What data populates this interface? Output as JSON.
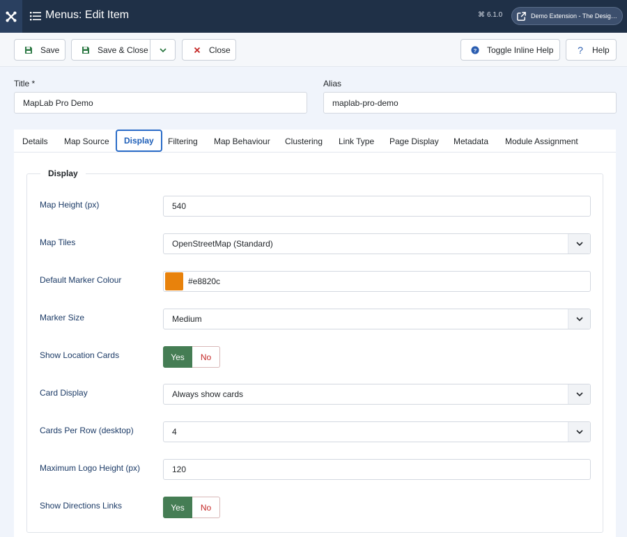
{
  "header": {
    "title": "Menus: Edit Item",
    "version": "6.1.0",
    "site_link": "Demo Extension - The Design..."
  },
  "toolbar": {
    "save": "Save",
    "save_close": "Save & Close",
    "close": "Close",
    "toggle_help": "Toggle Inline Help",
    "help": "Help"
  },
  "form": {
    "title_label": "Title *",
    "title_value": "MapLab Pro Demo",
    "alias_label": "Alias",
    "alias_value": "maplab-pro-demo"
  },
  "tabs": [
    "Details",
    "Map Source",
    "Display",
    "Filtering",
    "Map Behaviour",
    "Clustering",
    "Link Type",
    "Page Display",
    "Metadata",
    "Module Assignment"
  ],
  "active_tab": "Display",
  "fieldset": {
    "legend": "Display",
    "fields": {
      "map_height": {
        "label": "Map Height (px)",
        "value": "540"
      },
      "map_tiles": {
        "label": "Map Tiles",
        "value": "OpenStreetMap (Standard)"
      },
      "marker_colour": {
        "label": "Default Marker Colour",
        "value": "#e8820c",
        "swatch": "#e8820c"
      },
      "marker_size": {
        "label": "Marker Size",
        "value": "Medium"
      },
      "show_cards": {
        "label": "Show Location Cards",
        "yes": "Yes",
        "no": "No",
        "selected": "Yes"
      },
      "card_display": {
        "label": "Card Display",
        "value": "Always show cards"
      },
      "cards_per_row": {
        "label": "Cards Per Row (desktop)",
        "value": "4"
      },
      "max_logo_height": {
        "label": "Maximum Logo Height (px)",
        "value": "120"
      },
      "show_directions": {
        "label": "Show Directions Links",
        "yes": "Yes",
        "no": "No",
        "selected": "Yes"
      }
    }
  },
  "colors": {
    "header_bg": "#1f3047",
    "accent": "#2a6cc8",
    "yes_green": "#457d54",
    "no_red": "#c52827"
  }
}
